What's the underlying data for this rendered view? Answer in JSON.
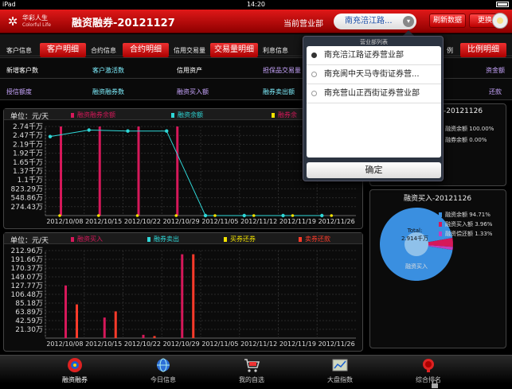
{
  "status": {
    "carrier": "iPad",
    "wifi": "wifi-icon",
    "time": "14:20",
    "battery": "battery-icon"
  },
  "header": {
    "logo_cn": "华彩人生",
    "logo_en": "Colorful Life",
    "title": "融资融券-20121127",
    "branch_label": "当前营业部",
    "branch_value": "南充涪江路...",
    "refresh": "刷新数据",
    "more": "更换"
  },
  "tabs": [
    {
      "label": "客户信息",
      "button": "客户明细"
    },
    {
      "label": "合约信息",
      "button": "合约明细"
    },
    {
      "label": "信用交易量",
      "button": "交易量明细"
    },
    {
      "label": "利息信息",
      "button": ""
    },
    {
      "label": "例",
      "button": "比例明细"
    }
  ],
  "grid": {
    "row1": [
      "新增客户数",
      "客户激活数",
      "信用资产",
      "担保品交易量",
      "资金额"
    ],
    "row2": [
      "授信额度",
      "融资融券数",
      "融资买入额",
      "融券卖出额",
      "还款"
    ]
  },
  "chart1": {
    "unit": "单位：元/天",
    "legend": [
      "融资融券余额",
      "融资余额",
      "融券余"
    ],
    "colors": [
      "#d6185a",
      "#2fd8d8",
      "#f2e200"
    ]
  },
  "chart2": {
    "unit": "单位：元/天",
    "legend": [
      "融资买入",
      "融券卖出",
      "买券还券",
      "卖券还款"
    ],
    "colors": [
      "#d6185a",
      "#2fd8d8",
      "#f2e200",
      "#ff3b2a"
    ]
  },
  "chart_data": [
    {
      "type": "bar",
      "title": "",
      "ylabel": "单位：元/天",
      "categories": [
        "2012/10/08",
        "2012/10/15",
        "2012/10/22",
        "2012/10/29",
        "2012/11/05",
        "2012/11/12",
        "2012/11/19",
        "2012/11/26"
      ],
      "yticks": [
        "2.74千万",
        "2.47千万",
        "2.19千万",
        "1.92千万",
        "1.65千万",
        "1.37千万",
        "1.1千万",
        "823.29万",
        "548.86万",
        "274.43万"
      ],
      "ylim": [
        0,
        2.74
      ],
      "series": [
        {
          "name": "融资融券余额",
          "values": [
            2.74,
            2.74,
            2.74,
            2.74,
            0,
            0,
            0,
            0
          ]
        },
        {
          "name": "融资余额",
          "values": [
            2.43,
            2.63,
            2.6,
            2.6,
            0,
            0,
            0,
            0
          ]
        },
        {
          "name": "融券余",
          "values": [
            0,
            0,
            0,
            0,
            0,
            0,
            0,
            0
          ]
        }
      ]
    },
    {
      "type": "bar",
      "title": "",
      "ylabel": "单位：元/天",
      "categories": [
        "2012/10/08",
        "2012/10/15",
        "2012/10/22",
        "2012/10/29",
        "2012/11/05",
        "2012/11/12",
        "2012/11/19",
        "2012/11/26"
      ],
      "yticks": [
        "212.96万",
        "191.66万",
        "170.37万",
        "149.07万",
        "127.77万",
        "106.48万",
        "85.18万",
        "63.89万",
        "42.59万",
        "21.30万"
      ],
      "ylim": [
        0,
        212.96
      ],
      "series": [
        {
          "name": "融资买入",
          "values": [
            128,
            50,
            8,
            204,
            0,
            0,
            0,
            0
          ]
        },
        {
          "name": "融券卖出",
          "values": [
            0,
            0,
            0,
            0,
            0,
            0,
            0,
            0
          ]
        },
        {
          "name": "买券还券",
          "values": [
            0,
            0,
            0,
            0,
            0,
            0,
            0,
            0
          ]
        },
        {
          "name": "卖券还款",
          "values": [
            82,
            65,
            5,
            204,
            0,
            0,
            0,
            0
          ]
        }
      ]
    },
    {
      "type": "pie",
      "title": "融资买入-20121126",
      "center_label": "Total:",
      "center_value": "2.914千万",
      "caption": "融资买入",
      "labels": [
        "融资余额 94.71%",
        "融资买入额 3.96%",
        "融资偿还额 1.33%"
      ],
      "values": [
        94.71,
        3.96,
        1.33
      ],
      "colors": [
        "#3a8fe0",
        "#d6185a",
        "#c040c0"
      ]
    }
  ],
  "right_top": {
    "title": "-20121126",
    "lines": [
      "融资余额 100.00%",
      "融券余额 0.00%"
    ]
  },
  "right_bottom": {
    "title": "融资买入-20121126"
  },
  "dropdown": {
    "header": "营业部列表",
    "items": [
      "南充涪江路证券营业部",
      "南充阆中天马寺街证券营...",
      "南充营山正西街证券营业部"
    ],
    "confirm": "确定"
  },
  "bottom": [
    {
      "label": "融资融券",
      "icon": "financing-icon"
    },
    {
      "label": "今日信息",
      "icon": "globe-icon"
    },
    {
      "label": "我的自选",
      "icon": "cart-icon"
    },
    {
      "label": "大盘指数",
      "icon": "chart-icon"
    },
    {
      "label": "综合排名",
      "icon": "ranking-icon"
    }
  ]
}
